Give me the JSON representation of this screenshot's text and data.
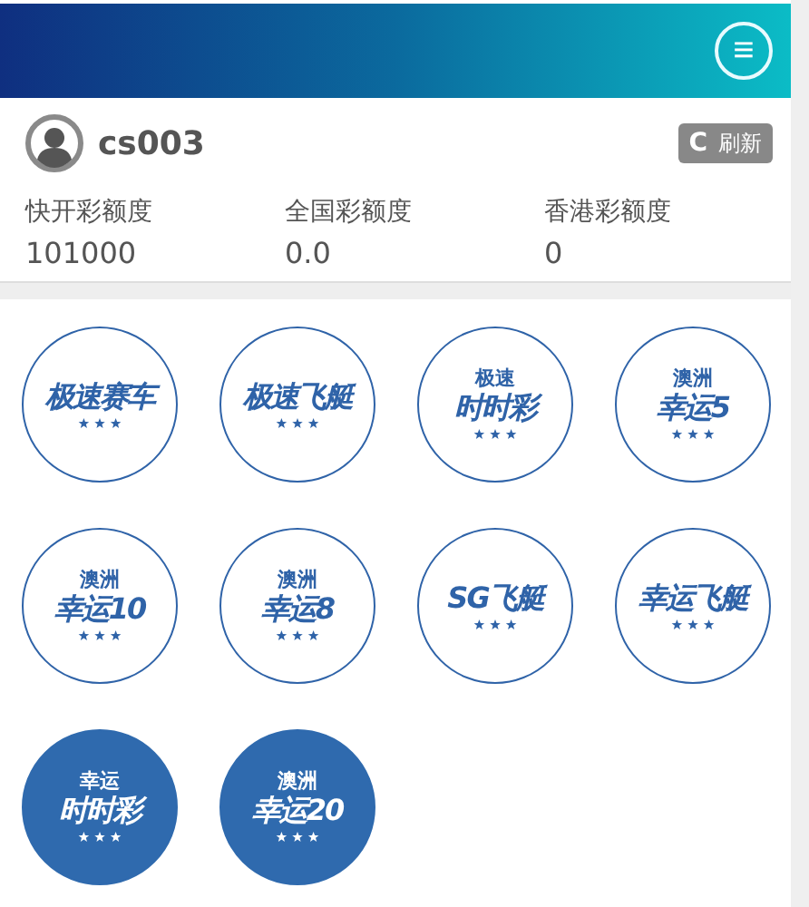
{
  "header": {
    "menu_button": "≡"
  },
  "user": {
    "name": "cs003",
    "refresh_button": {
      "icon": "C",
      "label": "刷新"
    }
  },
  "balances": [
    {
      "label": "快开彩额度",
      "value": "101000"
    },
    {
      "label": "全国彩额度",
      "value": "0.0"
    },
    {
      "label": "香港彩额度",
      "value": "0"
    }
  ],
  "games": [
    {
      "kind": "outline",
      "main": "极速赛车"
    },
    {
      "kind": "outline",
      "main": "极速飞艇"
    },
    {
      "kind": "outline",
      "top": "极速",
      "main": "时时彩"
    },
    {
      "kind": "outline",
      "top": "澳洲",
      "main": "幸运5"
    },
    {
      "kind": "outline",
      "top": "澳洲",
      "main": "幸运10"
    },
    {
      "kind": "outline",
      "top": "澳洲",
      "main": "幸运8"
    },
    {
      "kind": "outline",
      "main": "SG飞艇"
    },
    {
      "kind": "outline",
      "main": "幸运飞艇"
    },
    {
      "kind": "filled",
      "top": "幸运",
      "main": "时时彩"
    },
    {
      "kind": "filled",
      "top": "澳洲",
      "main": "幸运20"
    }
  ]
}
